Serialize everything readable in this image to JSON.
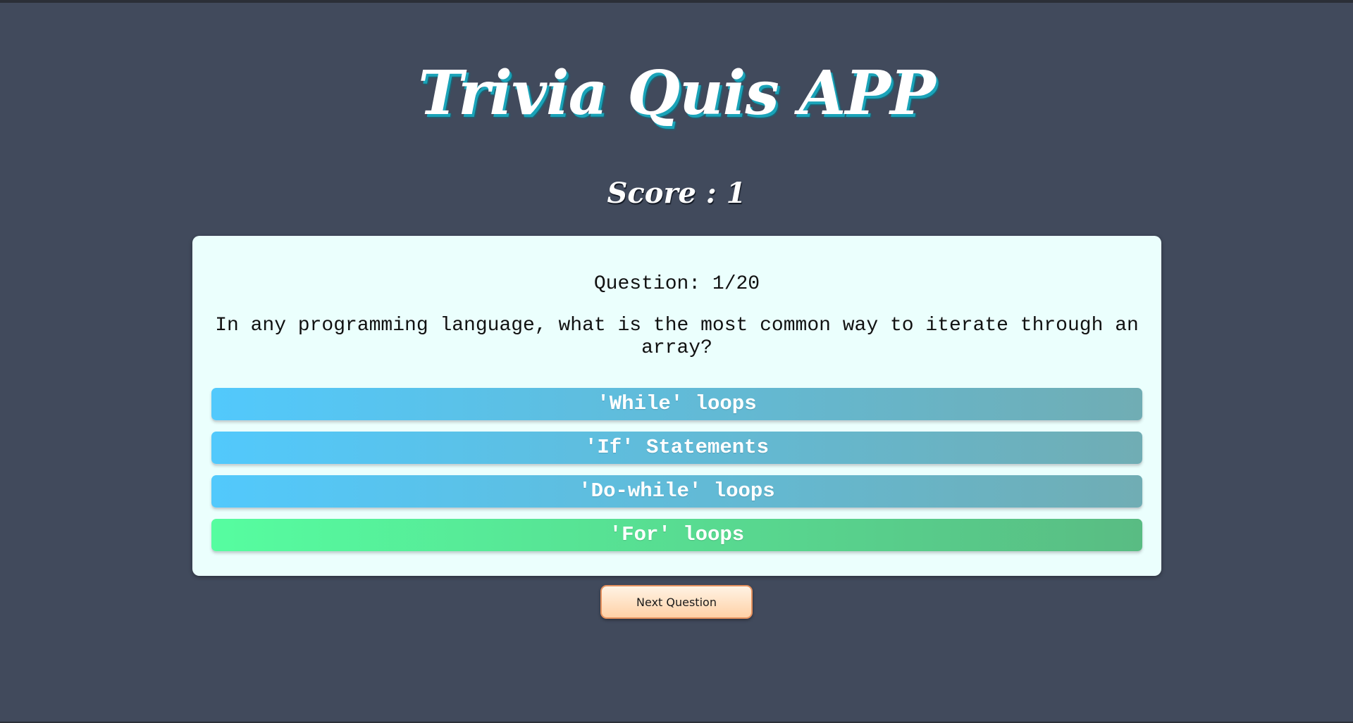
{
  "header": {
    "title": "Trivia Quis APP",
    "score_text": "Score : 1"
  },
  "quiz": {
    "question_number": "Question: 1/20",
    "question_text": "In any programming language, what is the most common way to iterate through an array?",
    "answers": [
      {
        "label": "'While' loops",
        "state": "default"
      },
      {
        "label": "'If' Statements",
        "state": "default"
      },
      {
        "label": "'Do-while' loops",
        "state": "default"
      },
      {
        "label": "'For' loops",
        "state": "correct"
      }
    ]
  },
  "controls": {
    "next_label": "Next Question"
  },
  "colors": {
    "background": "#414a5c",
    "card": "#ebfffd",
    "answer_default_start": "#52c9fc",
    "answer_default_end": "#70adb4",
    "answer_correct_start": "#56fda0",
    "answer_correct_end": "#59bc83",
    "next_button_border": "#e5915e"
  }
}
